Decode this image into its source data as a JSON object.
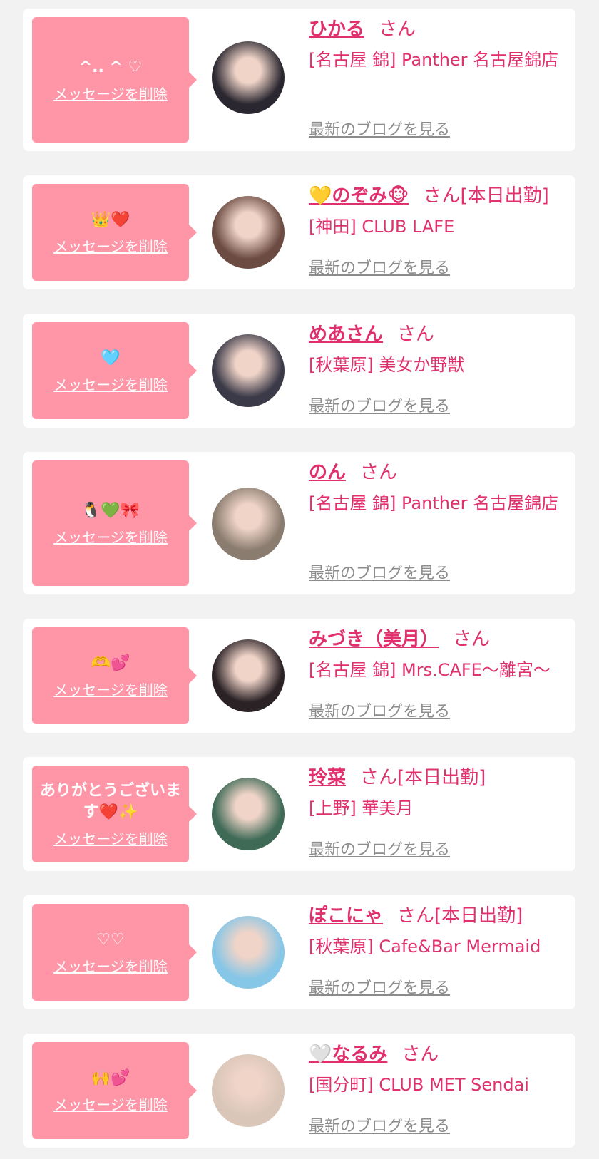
{
  "cards": [
    {
      "message": "^.. ^ ♡",
      "delete_label": "メッセージを削除",
      "name": "ひかる",
      "suffix": "さん",
      "shop": "[名古屋 錦] Panther 名古屋錦店",
      "blog_label": "最新のブログを見る",
      "avatar_color": "#2a2730"
    },
    {
      "message": "👑❤️",
      "delete_label": "メッセージを削除",
      "name": "💛のぞみ🐵",
      "suffix": "さん[本日出勤]",
      "shop": "[神田] CLUB LAFE",
      "blog_label": "最新のブログを見る",
      "avatar_color": "#6b4b42"
    },
    {
      "message": "🩵",
      "delete_label": "メッセージを削除",
      "name": "めあさん",
      "suffix": "さん",
      "shop": "[秋葉原] 美女か野獣",
      "blog_label": "最新のブログを見る",
      "avatar_color": "#3b3a48"
    },
    {
      "message": "🐧💚🎀",
      "delete_label": "メッセージを削除",
      "name": "のん",
      "suffix": "さん",
      "shop": "[名古屋 錦] Panther 名古屋錦店",
      "blog_label": "最新のブログを見る",
      "avatar_color": "#8b7c70"
    },
    {
      "message": "🫶💕",
      "delete_label": "メッセージを削除",
      "name": "みづき（美月）",
      "suffix": "さん",
      "shop": "[名古屋 錦] Mrs.CAFE〜離宮〜",
      "blog_label": "最新のブログを見る",
      "avatar_color": "#2b2226"
    },
    {
      "message": "ありがとうございます❤️✨",
      "delete_label": "メッセージを削除",
      "name": "玲菜",
      "suffix": "さん[本日出勤]",
      "shop": "[上野] 華美月",
      "blog_label": "最新のブログを見る",
      "avatar_color": "#3e6a56"
    },
    {
      "message": "♡♡",
      "delete_label": "メッセージを削除",
      "name": "ぽこにゃ",
      "suffix": "さん[本日出勤]",
      "shop": "[秋葉原] Cafe&Bar Mermaid",
      "blog_label": "最新のブログを見る",
      "avatar_color": "#86c6e6"
    },
    {
      "message": "🙌💕",
      "delete_label": "メッセージを削除",
      "name": "🤍なるみ",
      "suffix": "さん",
      "shop": "[国分町] CLUB MET Sendai",
      "blog_label": "最新のブログを見る",
      "avatar_color": "#d9c6b8"
    }
  ]
}
